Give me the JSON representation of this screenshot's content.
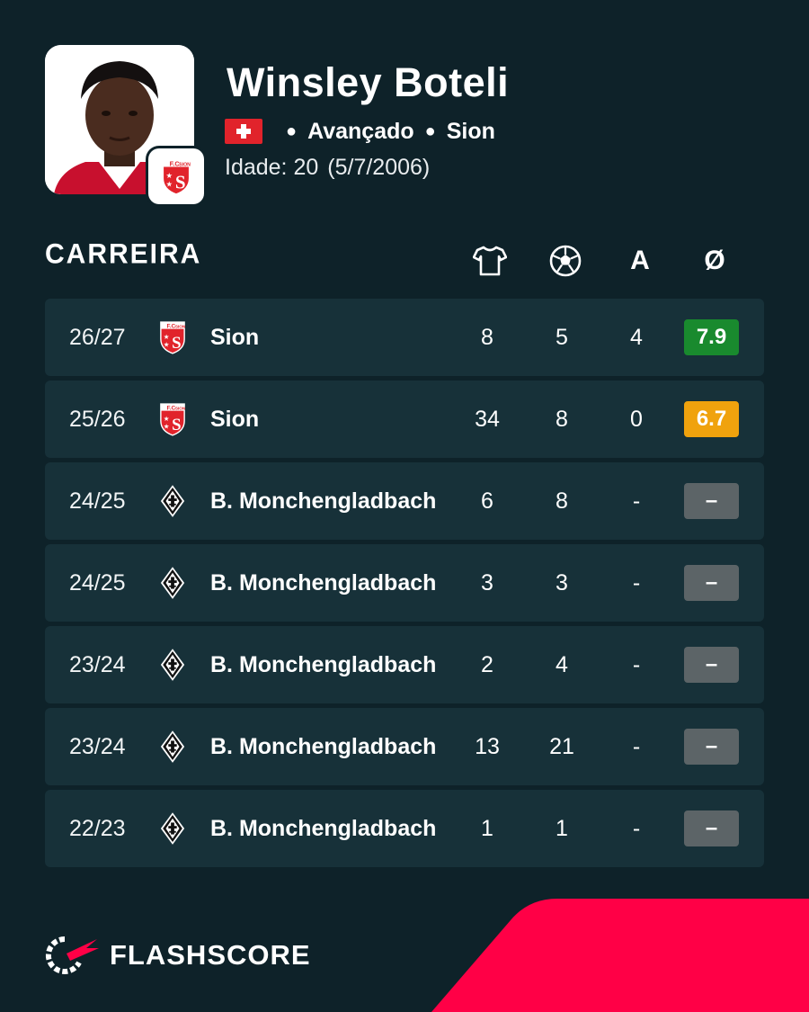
{
  "player": {
    "name": "Winsley Boteli",
    "position": "Avançado",
    "club": "Sion",
    "age_label": "Idade: 20",
    "birth_date": "(5/7/2006)",
    "nationality_flag": "switzerland-flag"
  },
  "career": {
    "title": "CARREIRA",
    "headers": {
      "apps_icon": "shirt-icon",
      "goals_icon": "ball-icon",
      "assists_label": "A",
      "rating_label": "Ø"
    },
    "rows": [
      {
        "season": "26/27",
        "team": "Sion",
        "club_logo": "sion-logo-icon",
        "apps": "8",
        "goals": "5",
        "assists": "4",
        "rating": "7.9",
        "rating_color": "#198a2e"
      },
      {
        "season": "25/26",
        "team": "Sion",
        "club_logo": "sion-logo-icon",
        "apps": "34",
        "goals": "8",
        "assists": "0",
        "rating": "6.7",
        "rating_color": "#f0a20d"
      },
      {
        "season": "24/25",
        "team": "B. Monchengladbach",
        "club_logo": "gladbach-logo-icon",
        "apps": "6",
        "goals": "8",
        "assists": "-",
        "rating": "–",
        "rating_color": "#5c6467"
      },
      {
        "season": "24/25",
        "team": "B. Monchengladbach",
        "club_logo": "gladbach-logo-icon",
        "apps": "3",
        "goals": "3",
        "assists": "-",
        "rating": "–",
        "rating_color": "#5c6467"
      },
      {
        "season": "23/24",
        "team": "B. Monchengladbach",
        "club_logo": "gladbach-logo-icon",
        "apps": "2",
        "goals": "4",
        "assists": "-",
        "rating": "–",
        "rating_color": "#5c6467"
      },
      {
        "season": "23/24",
        "team": "B. Monchengladbach",
        "club_logo": "gladbach-logo-icon",
        "apps": "13",
        "goals": "21",
        "assists": "-",
        "rating": "–",
        "rating_color": "#5c6467"
      },
      {
        "season": "22/23",
        "team": "B. Monchengladbach",
        "club_logo": "gladbach-logo-icon",
        "apps": "1",
        "goals": "1",
        "assists": "-",
        "rating": "–",
        "rating_color": "#5c6467"
      }
    ]
  },
  "brand": {
    "name": "FLASHSCORE"
  },
  "colors": {
    "background": "#0e2229",
    "row": "#173139",
    "accent": "#ff0046"
  }
}
